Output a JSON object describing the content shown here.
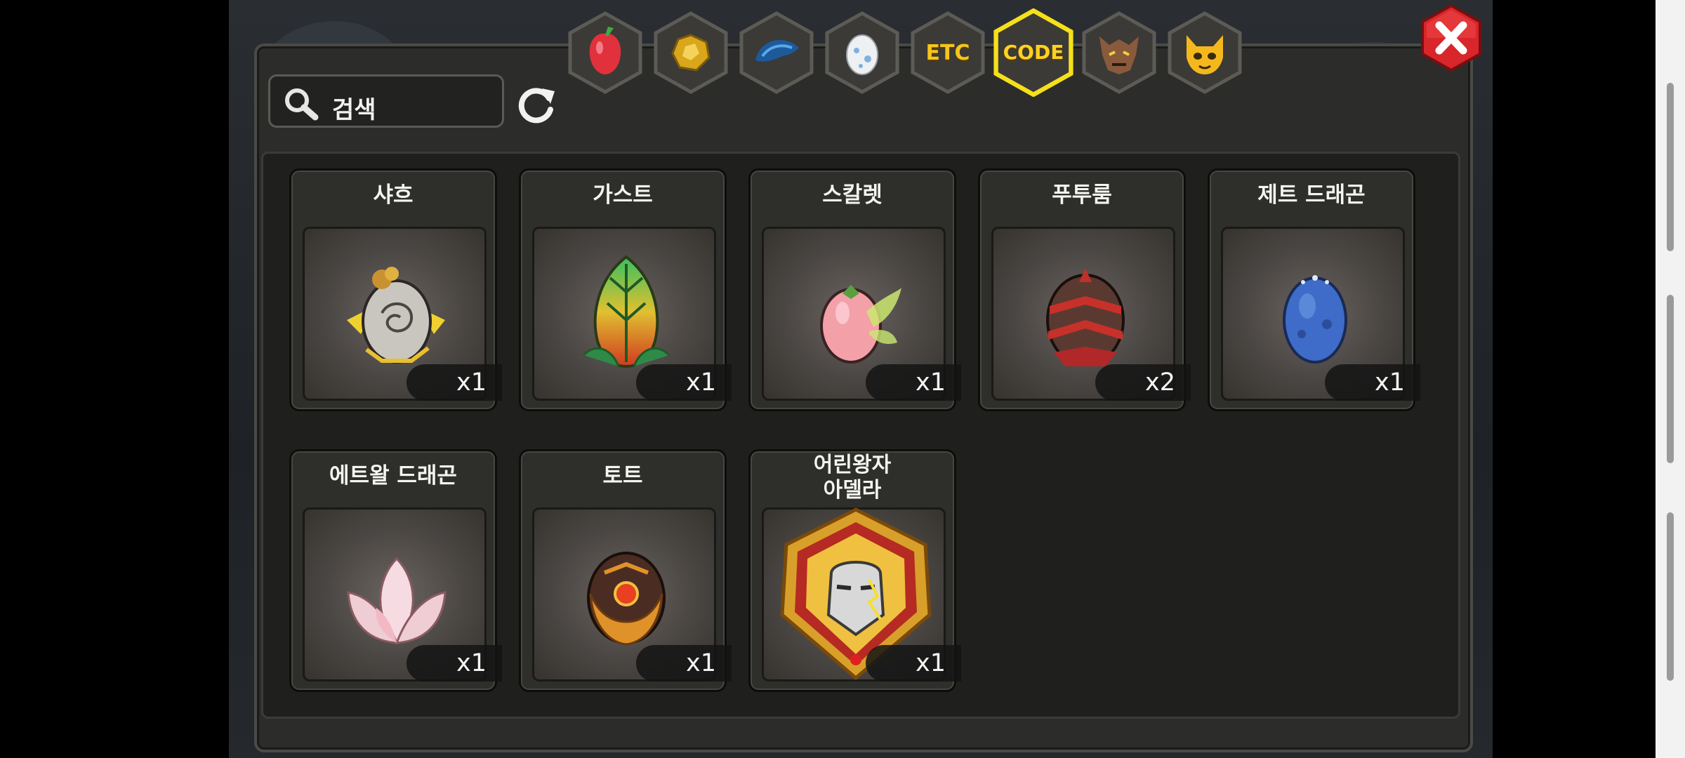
{
  "search": {
    "placeholder": "검색"
  },
  "tabs": [
    {
      "icon": "fruit-icon",
      "label": ""
    },
    {
      "icon": "gold-ore-icon",
      "label": ""
    },
    {
      "icon": "blue-scale-icon",
      "label": ""
    },
    {
      "icon": "egg-icon",
      "label": ""
    },
    {
      "icon": "text",
      "label": "ETC"
    },
    {
      "icon": "text",
      "label": "CODE",
      "selected": true
    },
    {
      "icon": "werewolf-icon",
      "label": ""
    },
    {
      "icon": "cat-mask-icon",
      "label": ""
    }
  ],
  "items": [
    {
      "name": "샤흐",
      "count": "x1",
      "icon": "silver-gold-egg-icon"
    },
    {
      "name": "가스트",
      "count": "x1",
      "icon": "leaf-egg-icon"
    },
    {
      "name": "스칼렛",
      "count": "x1",
      "icon": "pink-fairy-egg-icon"
    },
    {
      "name": "푸투룸",
      "count": "x2",
      "icon": "spiked-dark-egg-icon"
    },
    {
      "name": "제트 드래곤",
      "count": "x1",
      "icon": "blue-dragon-egg-icon"
    },
    {
      "name": "에트왈 드래곤",
      "count": "x1",
      "icon": "lotus-egg-icon"
    },
    {
      "name": "토트",
      "count": "x1",
      "icon": "armored-orange-egg-icon"
    },
    {
      "name": "어린왕자\n아델라",
      "name_line1": "어린왕자",
      "name_line2": "아델라",
      "count": "x1",
      "icon": "golden-helmet-emblem-icon"
    }
  ],
  "colors": {
    "selected_tab_border": "#f5e01a",
    "close_button": "#d8262a",
    "accent_text": "#ffd21f"
  }
}
